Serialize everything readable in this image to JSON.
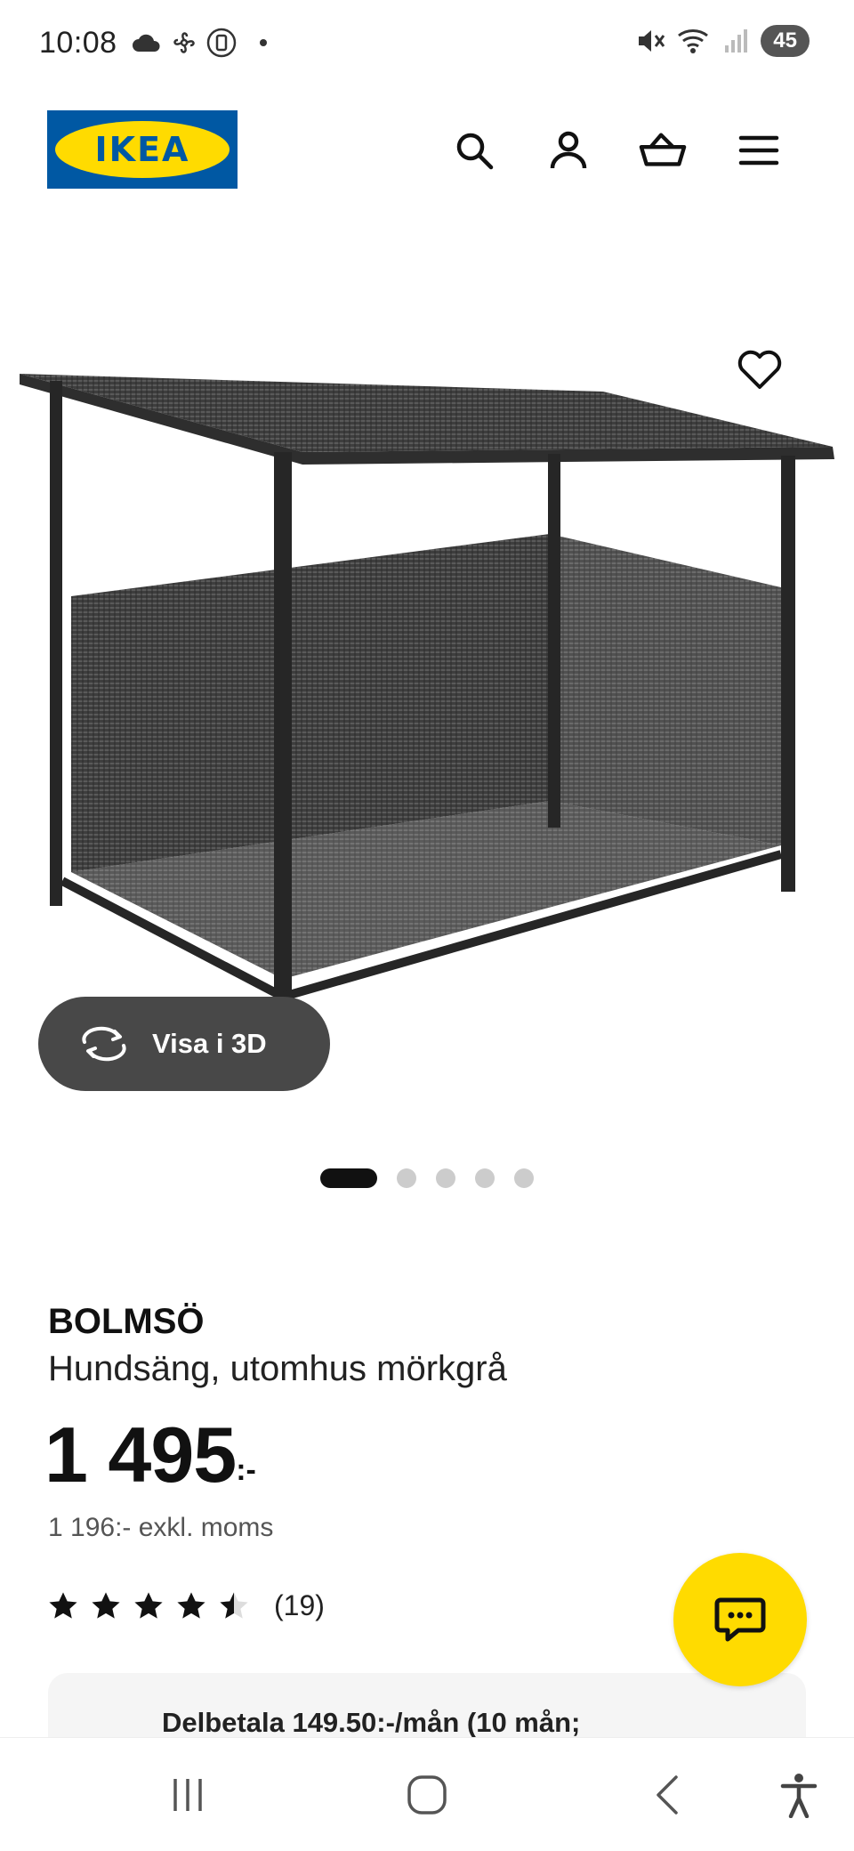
{
  "status_bar": {
    "time": "10:08",
    "battery": "45",
    "icons_left": [
      "cloud-icon",
      "fan-icon",
      "vibrate-icon"
    ],
    "icons_right": [
      "mute-icon",
      "wifi-icon",
      "signal-icon"
    ]
  },
  "header": {
    "logo_text": "IKEA",
    "icons": [
      "search-icon",
      "account-icon",
      "basket-icon",
      "menu-icon"
    ]
  },
  "gallery": {
    "view_3d_label": "Visa i 3D",
    "image_alt": "BOLMSÖ hundsäng",
    "dots_total": 5,
    "active_index": 0
  },
  "product": {
    "brand": "BOLMSÖ",
    "description": "Hundsäng, utomhus mörkgrå",
    "price": "1 495",
    "price_suffix": ":-",
    "price_excl": "1 196:- exkl. moms",
    "rating_value": 4.5,
    "rating_count": "(19)",
    "installment": "Delbetala 149.50:-/mån (10 mån;"
  },
  "colors": {
    "ikea_blue": "#0058a3",
    "ikea_yellow": "#ffdb00",
    "button_dark": "#484848"
  }
}
